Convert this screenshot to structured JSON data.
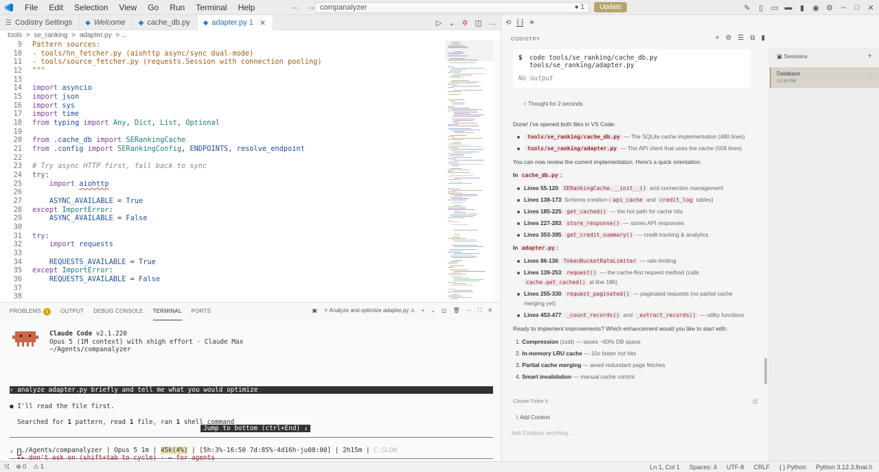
{
  "titlebar": {
    "menu": [
      "File",
      "Edit",
      "Selection",
      "View",
      "Go",
      "Run",
      "Terminal",
      "Help"
    ],
    "search": "companalyzer",
    "search_right": "● 1",
    "update": "Update"
  },
  "editor": {
    "tabs": [
      {
        "label": "Codistry Settings",
        "icon": "settings-file-icon"
      },
      {
        "label": "Welcome",
        "icon": "vscode-icon"
      },
      {
        "label": "cache_db.py",
        "icon": "python-icon"
      },
      {
        "label": "adapter.py 1",
        "icon": "python-icon"
      }
    ],
    "breadcrumb": [
      "tools",
      ">",
      "se_ranking",
      ">",
      "adapter.py",
      "> ..."
    ],
    "line_numbers": [
      "9",
      "10",
      "11",
      "12",
      "13",
      "14",
      "15",
      "16",
      "17",
      "18",
      "19",
      "20",
      "21",
      "22",
      "23",
      "24",
      "25",
      "26",
      "27",
      "28",
      "29",
      "30",
      "31",
      "32",
      "33",
      "34",
      "35",
      "36",
      "37",
      "38"
    ]
  },
  "panel": {
    "tabs": [
      "PROBLEMS",
      "OUTPUT",
      "DEBUG CONSOLE",
      "TERMINAL",
      "PORTS"
    ],
    "problems_count": "1",
    "task_label": "Analyze and optimize adapter.py",
    "terminal": {
      "app_name": "Claude Code",
      "version": "v2.1.220",
      "model_line": "Opus 5 (1M context) with xhigh effort · Claude Max",
      "cwd": "~/Agents/companalyzer",
      "prompt": "› analyze adapter.py briefly and tell me what you would optimize",
      "reply": "● I'll read the file first.",
      "searched_prefix": "Searched for ",
      "searched_n1": "1",
      "searched_mid1": " pattern, read ",
      "searched_n2": "1",
      "searched_mid2": " file, ran ",
      "searched_n3": "1",
      "searched_suffix": " shell command",
      "jump": "Jump to bottom (ctrl+End) ↓",
      "input_prompt": "›",
      "status_a": "../Agents/companalyzer | Opus 5 1m | ",
      "status_b": "45k(4%)",
      "status_c": " | [5h:3%-16:50 7d:85%-4d16h-ju08:00] | 2h15m | ",
      "status_d": "C:SLOW",
      "hint": "▸▸ don't ask on (shift+tab to cycle) · ← for agents"
    }
  },
  "statusbar": {
    "left": [
      "⊗ 0",
      "⚠ 1"
    ],
    "right": [
      "Ln 1, Col 1",
      "Spaces: 4",
      "UTF-8",
      "CRLF",
      "{ } Python",
      "Python 3.12.3.final.0"
    ]
  },
  "chat": {
    "label": "CODISTRY",
    "cmd_line1": "code tools/se_ranking/cache_db.py",
    "cmd_line2": "tools/se_ranking/adapter.py",
    "no_output": "No output",
    "thought": "Thought for 2 seconds",
    "done": "Done! I've opened both files in VS Code:",
    "file1": "tools/se_ranking/cache_db.py",
    "file1_desc": " — The SQLite cache implementation (480 lines)",
    "file2": "tools/se_ranking/adapter.py",
    "file2_desc": " — The API client that uses the cache (559 lines)",
    "review": "You can now review the current implementation. Here's a quick orientation:",
    "in_cache_a": "In ",
    "in_cache_b": "cache_db.py",
    "in_cache_c": ":",
    "cache_items": [
      {
        "lines": "Lines 55-120",
        "code": "SERankingCache.__init__()",
        "desc": " and connection management"
      },
      {
        "lines": "Lines 138-173",
        "pre": " Schema creation (",
        "code": "api_cache",
        "mid": " and ",
        "code2": "credit_log",
        "desc": " tables)"
      },
      {
        "lines": "Lines 185-225",
        "code": "get_cached()",
        "desc": " — the hot path for cache hits"
      },
      {
        "lines": "Lines 227-283",
        "code": "store_response()",
        "desc": " — stores API responses"
      },
      {
        "lines": "Lines 353-395",
        "code": "get_credit_summary()",
        "desc": " — credit tracking & analytics"
      }
    ],
    "in_adapter_a": "In ",
    "in_adapter_b": "adapter.py",
    "in_adapter_c": ":",
    "adapter_items": [
      {
        "lines": "Lines 86-136",
        "code": "TokenBucketRateLimiter",
        "desc": " — rate limiting"
      },
      {
        "lines": "Lines 139-253",
        "code": "request()",
        "desc": " — the cache-first request method (calls"
      },
      {
        "cont_code": "cache.get_cached()",
        "cont_desc": " at line 186)"
      },
      {
        "lines": "Lines 255-330",
        "code": "request_paginated()",
        "desc": " — paginated requests (no partial cache"
      },
      {
        "cont_desc": "merging yet)"
      },
      {
        "lines": "Lines 453-477",
        "code": "_count_records()",
        "mid": " and ",
        "code2": "_extract_records()",
        "desc": " — utility functions"
      }
    ],
    "ready": "Ready to implement improvements? Which enhancement would you like to start with:",
    "options": [
      {
        "n": "1.",
        "bold": "Compression",
        "desc": " (zstd) — saves ~60% DB space"
      },
      {
        "n": "2.",
        "bold": "In-memory LRU cache",
        "desc": " — 10x faster hot hits"
      },
      {
        "n": "3.",
        "bold": "Partial cache merging",
        "desc": " — avoid redundant page fetches"
      },
      {
        "n": "4.",
        "bold": "Smart invalidation",
        "desc": " — manual cache control"
      }
    ],
    "model": "Claude Fable 5  ·",
    "add_context": "Add Context",
    "ask_placeholder": "Ask Codistry anything..."
  },
  "sessions": {
    "header": "Sessions",
    "item_title": "Database",
    "item_time": "12:36 PM"
  }
}
